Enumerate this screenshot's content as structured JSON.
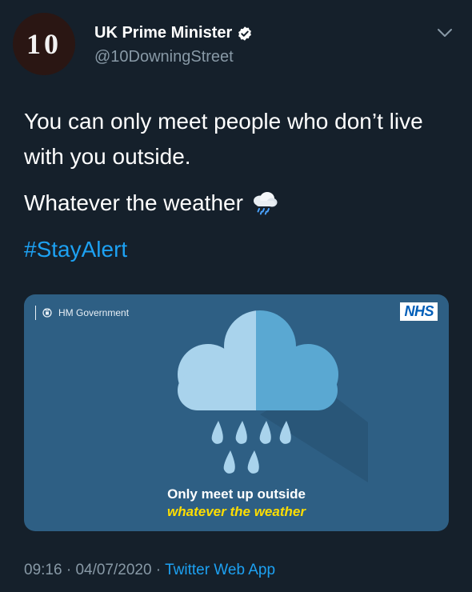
{
  "author": {
    "avatar_text": "10",
    "display_name": "UK Prime Minister",
    "handle": "@10DowningStreet",
    "verified": true
  },
  "tweet": {
    "line1": "You can only meet people who don’t live with you outside.",
    "line2": "Whatever the weather",
    "hashtag": "#StayAlert",
    "emoji_icon": "cloud-with-rain-icon"
  },
  "media": {
    "gov_label": "HM Government",
    "nhs_label": "NHS",
    "headline": "Only meet up outside",
    "subline": "whatever the weather"
  },
  "meta": {
    "time": "09:16",
    "date": "04/07/2020",
    "separator": " · ",
    "source": "Twitter Web App"
  },
  "colors": {
    "background": "#15202b",
    "link": "#1da1f2",
    "secondary_text": "#8899a6",
    "poster_bg": "#2e5f84",
    "poster_highlight": "#ffde00"
  }
}
